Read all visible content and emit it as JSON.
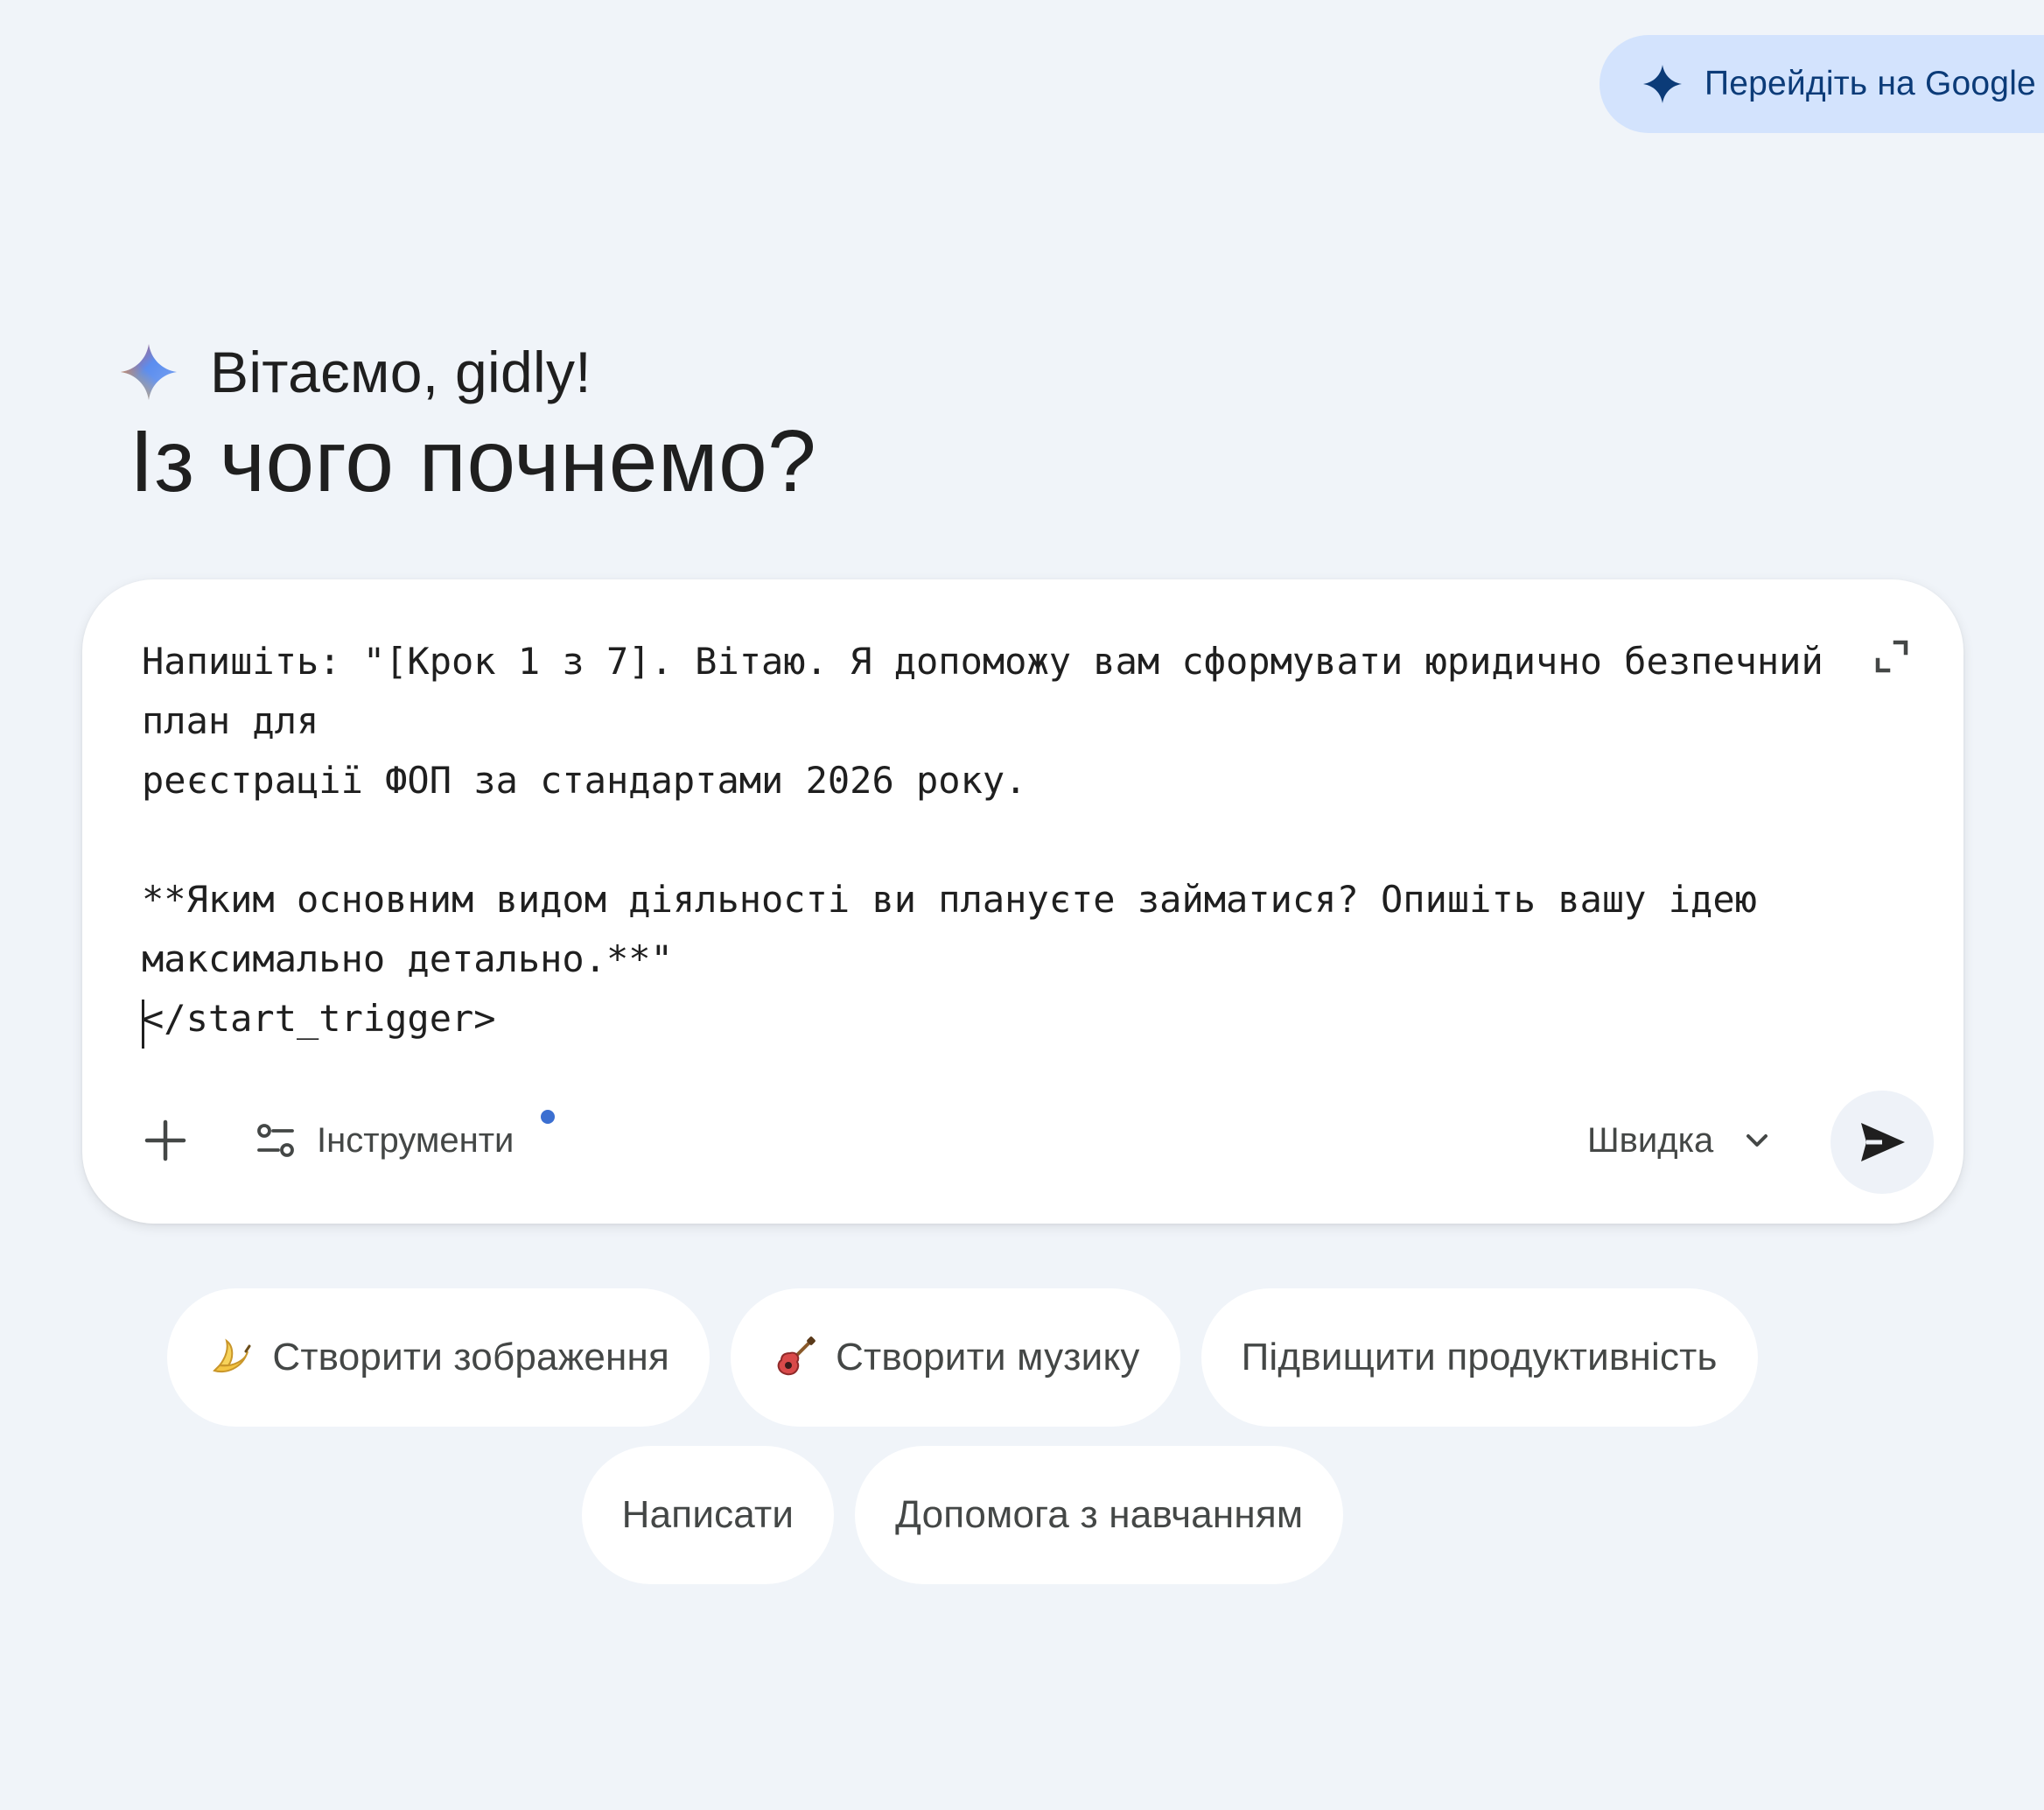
{
  "upgrade": {
    "label": "Перейдіть на Google"
  },
  "greeting": {
    "hello": "Вітаємо, gidly!",
    "headline": "Із чого почнемо?"
  },
  "prompt": {
    "text": "Напишіть: \"[Крок 1 з 7]. Вітаю. Я допоможу вам сформувати юридично безпечний план для\nреєстрації ФОП за стандартами 2026 року.\n\n**Яким основним видом діяльності ви плануєте займатися? Опишіть вашу ідею\nмаксимально детально.**\"\n</start_trigger>"
  },
  "toolbar": {
    "tools_label": "Інструменти",
    "mode_label": "Швидка"
  },
  "chips": [
    {
      "label": "Створити зображення",
      "icon": "banana-icon"
    },
    {
      "label": "Створити музику",
      "icon": "guitar-icon"
    },
    {
      "label": "Підвищити продуктивність"
    },
    {
      "label": "Написати"
    },
    {
      "label": "Допомога з навчанням"
    }
  ],
  "colors": {
    "background": "#f0f4f9",
    "upgrade_pill": "#d3e3fd",
    "upgrade_text": "#0b3b78",
    "accent_dot": "#3b6fd1"
  }
}
